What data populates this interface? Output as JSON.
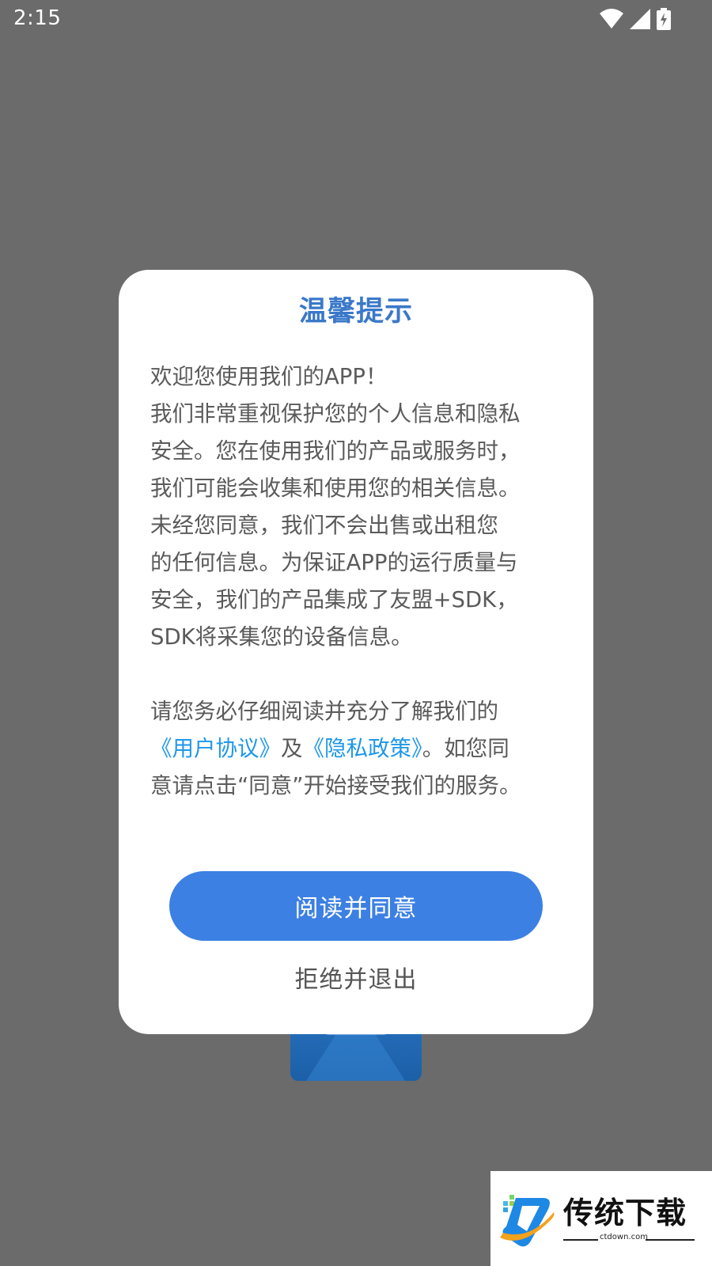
{
  "status_bar": {
    "time": "2:15",
    "icons": [
      "wifi-icon",
      "cellular-signal-icon",
      "battery-charging-icon"
    ]
  },
  "dialog": {
    "title": "温馨提示",
    "paragraph1": [
      "欢迎您使用我们的APP！",
      "我们非常重视保护您的个人信息和隐私",
      "安全。您在使用我们的产品或服务时，",
      "我们可能会收集和使用您的相关信息。",
      "未经您同意，我们不会出售或出租您",
      "的任何信息。为保证APP的运行质量与",
      "安全，我们的产品集成了友盟+SDK，",
      "SDK将采集您的设备信息。"
    ],
    "paragraph2": {
      "line1": "请您务必仔细阅读并充分了解我们的",
      "user_agreement_link": "《用户协议》",
      "connector": "及",
      "privacy_policy_link": "《隐私政策》",
      "line2_tail": "。如您同",
      "line3": "意请点击“同意”开始接受我们的服务。"
    },
    "agree_button": "阅读并同意",
    "reject_button": "拒绝并退出"
  },
  "watermark": {
    "brand": "传统下载",
    "url": "ctdown.com"
  },
  "colors": {
    "overlay": "#6b6b6b",
    "title": "#3a78c9",
    "link": "#1f97ea",
    "primary_button": "#3d80e3"
  }
}
